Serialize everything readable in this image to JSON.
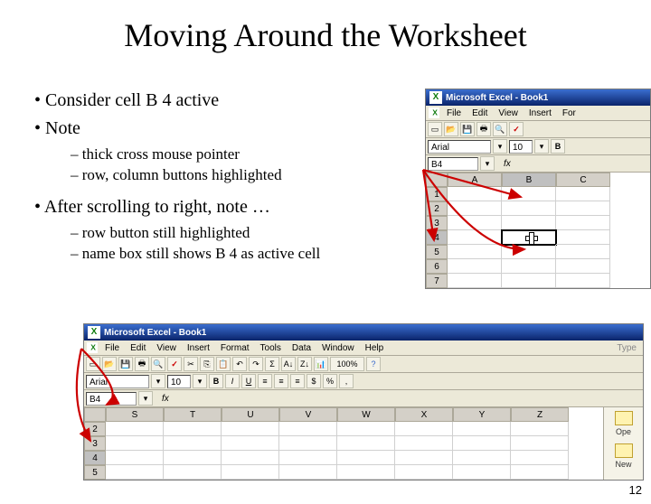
{
  "title": "Moving Around the Worksheet",
  "bullets": {
    "b1": "Consider cell B 4 active",
    "b2": "Note",
    "sub1a": "thick cross mouse pointer",
    "sub1b": "row, column buttons highlighted",
    "b3": "After scrolling to right, note …",
    "sub2a": "row button still highlighted",
    "sub2b": "name box still shows B 4 as active cell"
  },
  "excel": {
    "app_title": "Microsoft Excel - Book1",
    "menus1": [
      "File",
      "Edit",
      "View",
      "Insert",
      "For"
    ],
    "menus2": [
      "File",
      "Edit",
      "View",
      "Insert",
      "Format",
      "Tools",
      "Data",
      "Window",
      "Help"
    ],
    "font_name": "Arial",
    "font_size": "10",
    "namebox": "B4",
    "fx": "fx",
    "cols1": [
      "A",
      "B",
      "C"
    ],
    "rows1": [
      "1",
      "2",
      "3",
      "4",
      "5",
      "6",
      "7"
    ],
    "cols2": [
      "S",
      "T",
      "U",
      "V",
      "W",
      "X",
      "Y",
      "Z"
    ],
    "rows2": [
      "2",
      "3",
      "4",
      "5"
    ],
    "zoom": "100%",
    "type_help": "Type",
    "taskpane_items": [
      "Ope",
      "New"
    ]
  },
  "page_number": "12"
}
